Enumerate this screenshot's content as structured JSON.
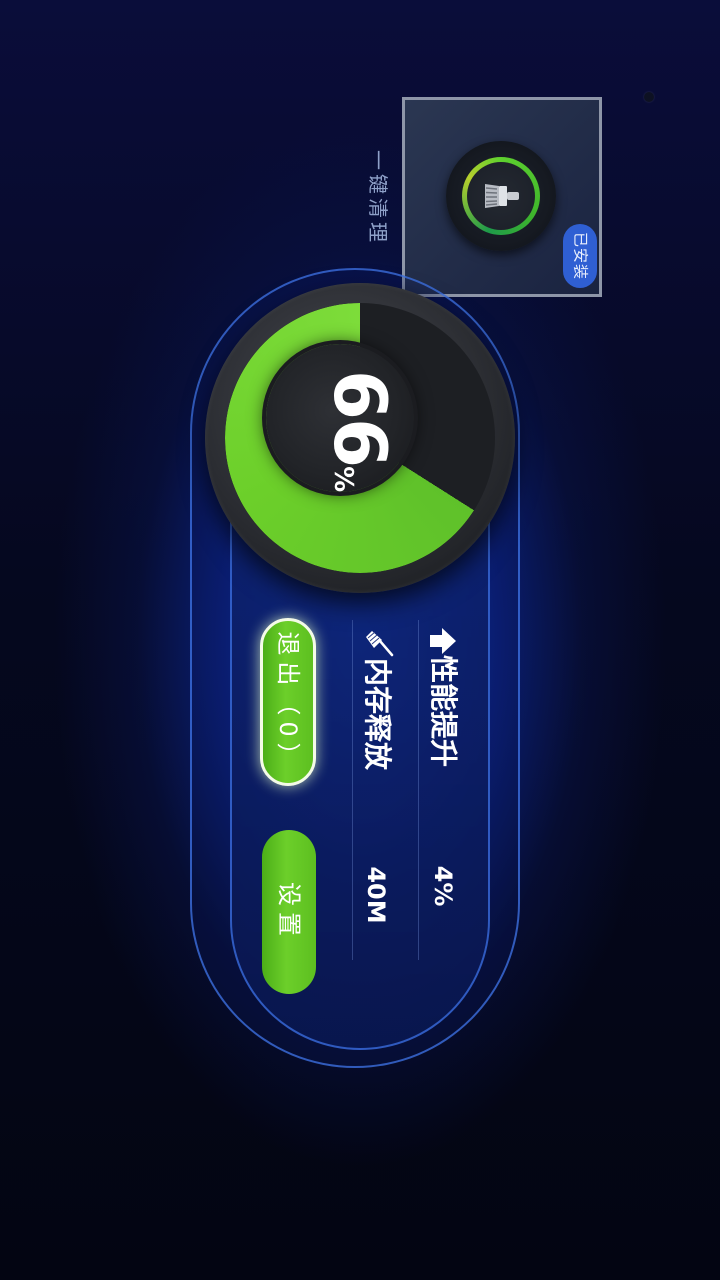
{
  "widget": {
    "title": "一键清理",
    "badge": "已安装"
  },
  "dial": {
    "value": "66",
    "unit": "%",
    "progress_fraction": 0.66
  },
  "stats": {
    "performance": {
      "label": "性能提升",
      "value": "4%"
    },
    "memory": {
      "label": "内存释放",
      "value": "40M"
    }
  },
  "buttons": {
    "exit_label": "退出（0）",
    "settings_label": "设置"
  },
  "colors": {
    "accent_green": "#6ccf2a",
    "panel_blue": "#3a6cdc",
    "badge_blue": "#2f5fd3"
  },
  "icons": {
    "widget": "brush-icon",
    "performance": "arrow-up-icon",
    "memory": "broom-icon"
  }
}
